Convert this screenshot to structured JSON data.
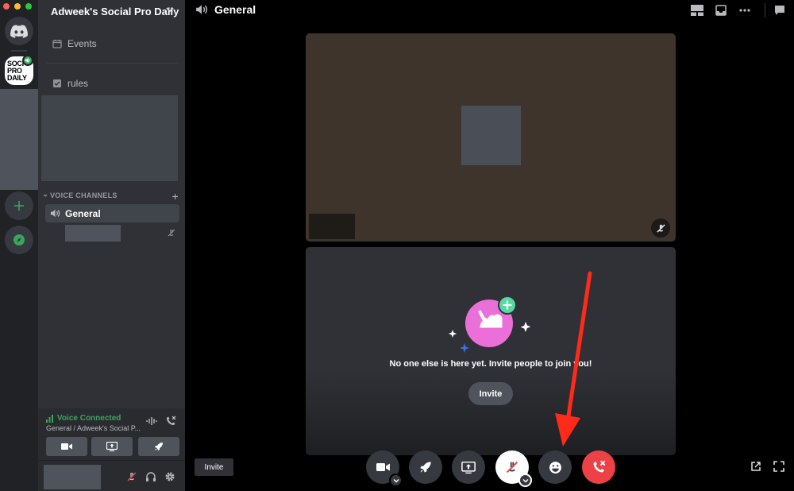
{
  "window": {
    "traffic_lights": [
      "#ff5f57",
      "#febc2e",
      "#28c840"
    ]
  },
  "rail": {
    "servers": [
      {
        "name": "home",
        "icon": "discord-logo-icon"
      },
      {
        "name": "adweeks-social-pro-daily",
        "logo_lines": [
          "SOCI",
          "PRO",
          "DAILY"
        ],
        "voice_active": true
      },
      {
        "name": "add-server",
        "icon": "plus-icon"
      },
      {
        "name": "explore",
        "icon": "compass-icon"
      }
    ]
  },
  "sidebar": {
    "guild_name": "Adweek's Social Pro Daily",
    "channels": [
      {
        "label": "Events",
        "icon": "calendar-icon"
      },
      {
        "label": "rules",
        "icon": "checkbox-icon"
      }
    ],
    "voice_section_label": "VOICE CHANNELS",
    "voice_channel": {
      "label": "General",
      "icon": "speaker-icon"
    }
  },
  "voice_panel": {
    "status": "Voice Connected",
    "channel": "General / Adweek's Social P...",
    "status_color": "#3ba55d"
  },
  "main": {
    "title": "General",
    "empty_text": "No one else is here yet. Invite people to join you!",
    "invite_tile_label": "Invite",
    "invite_label": "Invite"
  },
  "controls": [
    {
      "name": "camera",
      "icon": "camera-icon"
    },
    {
      "name": "activity",
      "icon": "rocket-icon"
    },
    {
      "name": "screen-share",
      "icon": "screen-share-icon"
    },
    {
      "name": "mute",
      "icon": "microphone-muted-icon"
    },
    {
      "name": "emoji",
      "icon": "smiley-icon"
    },
    {
      "name": "disconnect",
      "icon": "phone-hangup-icon"
    }
  ],
  "colors": {
    "accent_green": "#3ba55d",
    "danger_red": "#ed4245",
    "annotation_arrow": "#ff2a1a",
    "illustration_pink": "#eb6fd8"
  }
}
